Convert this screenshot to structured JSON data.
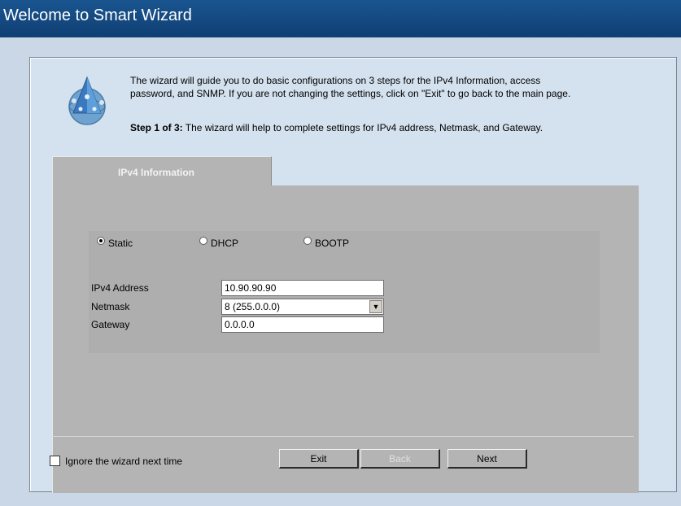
{
  "header": {
    "title": "Welcome to Smart Wizard"
  },
  "intro": {
    "line1": "The wizard will guide you to do basic configurations on 3 steps for the IPv4 Information, access",
    "line2": "password, and SNMP. If you are not changing the settings, click on \"Exit\" to go back to the main page."
  },
  "step": {
    "prefix": "Step 1 of 3:",
    "text": " The wizard will help to complete settings for IPv4 address, Netmask, and Gateway."
  },
  "tabs": [
    {
      "label": "IPv4 Information"
    }
  ],
  "mode": {
    "options": [
      {
        "label": "Static",
        "checked": true
      },
      {
        "label": "DHCP",
        "checked": false
      },
      {
        "label": "BOOTP",
        "checked": false
      }
    ]
  },
  "fields": {
    "ipv4_address": {
      "label": "IPv4 Address",
      "value": "10.90.90.90"
    },
    "netmask": {
      "label": "Netmask",
      "value": "8 (255.0.0.0)"
    },
    "gateway": {
      "label": "Gateway",
      "value": "0.0.0.0"
    }
  },
  "footer": {
    "ignore_label": "Ignore the wizard next time",
    "ignore_checked": false,
    "buttons": {
      "exit": "Exit",
      "back": "Back",
      "next": "Next"
    }
  },
  "icons": {
    "logo": "wizard-pyramid-globe-icon",
    "select_arrow": "chevron-down-icon"
  },
  "colors": {
    "header": "#1a5590",
    "panel": "#b4b4b4",
    "background": "#c9d7e6"
  }
}
